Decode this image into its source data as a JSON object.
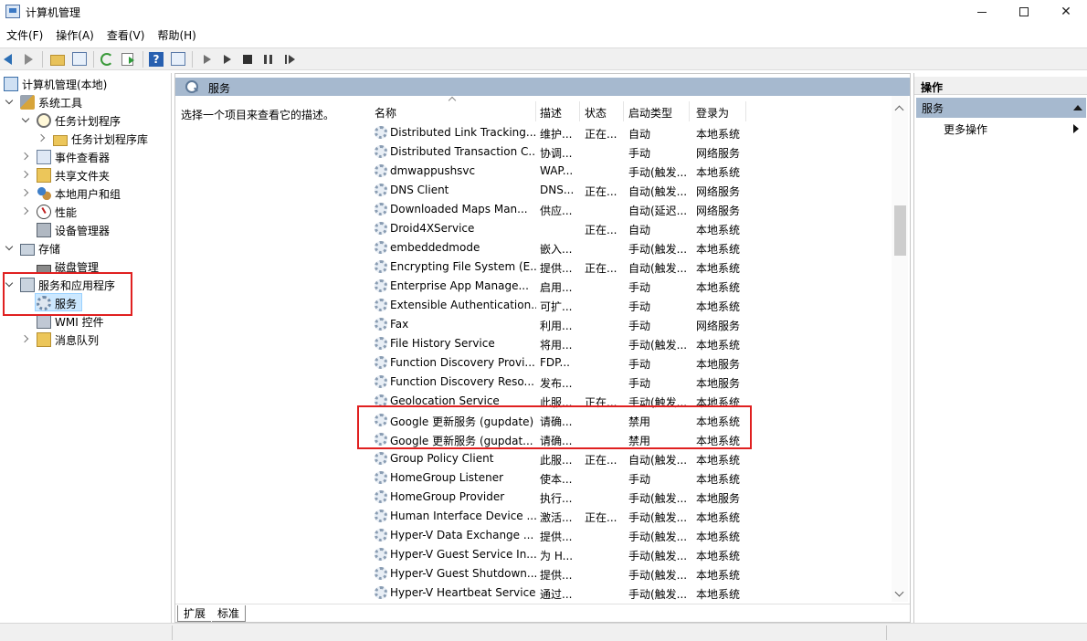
{
  "window": {
    "title": "计算机管理",
    "controls": {
      "minimize": "",
      "maximize": "",
      "close": "✕"
    }
  },
  "menu": [
    "文件(F)",
    "操作(A)",
    "查看(V)",
    "帮助(H)"
  ],
  "toolbar": {
    "icons": [
      "back-icon",
      "forward-icon",
      "up-folder-icon",
      "show-hide-tree-icon",
      "refresh-icon",
      "export-list-icon",
      "help-icon",
      "properties-icon",
      "start-service-icon",
      "start-service-alt-icon",
      "stop-service-icon",
      "pause-service-icon",
      "restart-service-icon"
    ]
  },
  "tree": {
    "root": "计算机管理(本地)",
    "system_tools": "系统工具",
    "task_scheduler": "任务计划程序",
    "task_scheduler_library": "任务计划程序库",
    "event_viewer": "事件查看器",
    "shared_folders": "共享文件夹",
    "local_users_groups": "本地用户和组",
    "performance": "性能",
    "device_manager": "设备管理器",
    "storage": "存储",
    "disk_management": "磁盘管理",
    "services_apps": "服务和应用程序",
    "services": "服务",
    "wmi_control": "WMI 控件",
    "message_queuing": "消息队列"
  },
  "main": {
    "header_title": "服务",
    "description_prompt": "选择一个项目来查看它的描述。",
    "columns": {
      "name": "名称",
      "description": "描述",
      "status": "状态",
      "startup_type": "启动类型",
      "logon_as": "登录为"
    },
    "services": [
      {
        "name": "Distributed Link Tracking...",
        "description": "维护...",
        "status": "正在...",
        "startup": "自动",
        "logon": "本地系统"
      },
      {
        "name": "Distributed Transaction C...",
        "description": "协调...",
        "status": "",
        "startup": "手动",
        "logon": "网络服务"
      },
      {
        "name": "dmwappushsvc",
        "description": "WAP...",
        "status": "",
        "startup": "手动(触发...",
        "logon": "本地系统"
      },
      {
        "name": "DNS Client",
        "description": "DNS...",
        "status": "正在...",
        "startup": "自动(触发...",
        "logon": "网络服务"
      },
      {
        "name": "Downloaded Maps Man...",
        "description": "供应...",
        "status": "",
        "startup": "自动(延迟...",
        "logon": "网络服务"
      },
      {
        "name": "Droid4XService",
        "description": "",
        "status": "正在...",
        "startup": "自动",
        "logon": "本地系统"
      },
      {
        "name": "embeddedmode",
        "description": "嵌入...",
        "status": "",
        "startup": "手动(触发...",
        "logon": "本地系统"
      },
      {
        "name": "Encrypting File System (E...",
        "description": "提供...",
        "status": "正在...",
        "startup": "自动(触发...",
        "logon": "本地系统"
      },
      {
        "name": "Enterprise App Manage...",
        "description": "启用...",
        "status": "",
        "startup": "手动",
        "logon": "本地系统"
      },
      {
        "name": "Extensible Authentication...",
        "description": "可扩...",
        "status": "",
        "startup": "手动",
        "logon": "本地系统"
      },
      {
        "name": "Fax",
        "description": "利用...",
        "status": "",
        "startup": "手动",
        "logon": "网络服务"
      },
      {
        "name": "File History Service",
        "description": "将用...",
        "status": "",
        "startup": "手动(触发...",
        "logon": "本地系统"
      },
      {
        "name": "Function Discovery Provi...",
        "description": "FDP...",
        "status": "",
        "startup": "手动",
        "logon": "本地服务"
      },
      {
        "name": "Function Discovery Reso...",
        "description": "发布...",
        "status": "",
        "startup": "手动",
        "logon": "本地服务"
      },
      {
        "name": "Geolocation Service",
        "description": "此服...",
        "status": "正在...",
        "startup": "手动(触发...",
        "logon": "本地系统"
      },
      {
        "name": "Google 更新服务 (gupdate)",
        "description": "请确...",
        "status": "",
        "startup": "禁用",
        "logon": "本地系统"
      },
      {
        "name": "Google 更新服务 (gupdat...",
        "description": "请确...",
        "status": "",
        "startup": "禁用",
        "logon": "本地系统"
      },
      {
        "name": "Group Policy Client",
        "description": "此服...",
        "status": "正在...",
        "startup": "自动(触发...",
        "logon": "本地系统"
      },
      {
        "name": "HomeGroup Listener",
        "description": "使本...",
        "status": "",
        "startup": "手动",
        "logon": "本地系统"
      },
      {
        "name": "HomeGroup Provider",
        "description": "执行...",
        "status": "",
        "startup": "手动(触发...",
        "logon": "本地服务"
      },
      {
        "name": "Human Interface Device ...",
        "description": "激活...",
        "status": "正在...",
        "startup": "手动(触发...",
        "logon": "本地系统"
      },
      {
        "name": "Hyper-V Data Exchange ...",
        "description": "提供...",
        "status": "",
        "startup": "手动(触发...",
        "logon": "本地系统"
      },
      {
        "name": "Hyper-V Guest Service In...",
        "description": "为 H...",
        "status": "",
        "startup": "手动(触发...",
        "logon": "本地系统"
      },
      {
        "name": "Hyper-V Guest Shutdown...",
        "description": "提供...",
        "status": "",
        "startup": "手动(触发...",
        "logon": "本地系统"
      },
      {
        "name": "Hyper-V Heartbeat Service",
        "description": "通过...",
        "status": "",
        "startup": "手动(触发...",
        "logon": "本地系统"
      }
    ],
    "tabs": [
      "扩展",
      "标准"
    ]
  },
  "actions": {
    "title": "操作",
    "group": "服务",
    "more": "更多操作"
  },
  "colors": {
    "header_band": "#a6b9cf",
    "selection": "#cce8ff",
    "annotation": "#e02020"
  }
}
